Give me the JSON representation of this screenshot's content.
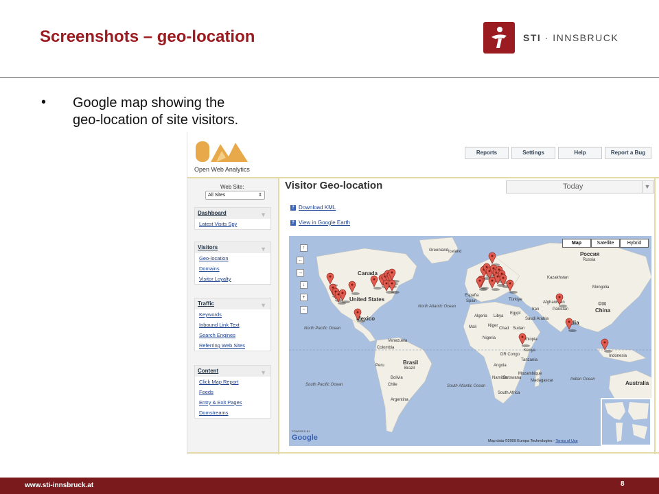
{
  "slide": {
    "title": "Screenshots – geo-location",
    "logo_brand": "STI",
    "logo_sep": " · ",
    "logo_name": "INNSBRUCK",
    "bullet": "•",
    "bullet_text": "Google map showing the geo-location of site visitors.",
    "footer_url": "www.sti-innsbruck.at",
    "page_number": "8"
  },
  "owa": {
    "app_name": "Open Web Analytics",
    "top_nav": [
      "Reports",
      "Settings",
      "Help",
      "Report a Bug"
    ],
    "web_site_label": "Web Site:",
    "web_site_value": "All Sites",
    "sections": [
      {
        "title": "Dashboard",
        "items": [
          "Latest Visits Spy"
        ]
      },
      {
        "title": "Visitors",
        "items": [
          "Geo-location",
          "Domains",
          "Visitor Loyalty"
        ]
      },
      {
        "title": "Traffic",
        "items": [
          "Keywords",
          "Inbound Link Text",
          "Search Engines",
          "Referring Web Sites"
        ]
      },
      {
        "title": "Content",
        "items": [
          "Click Map Report",
          "Feeds",
          "Entry & Exit Pages",
          "Domstreams"
        ]
      }
    ],
    "page_title": "Visitor Geo-location",
    "period": "Today",
    "links": [
      "Download KML",
      "View in Google Earth"
    ]
  },
  "map": {
    "types": [
      "Map",
      "Satellite",
      "Hybrid"
    ],
    "selected_type": "Map",
    "powered_by": "POWERED BY",
    "google": "Google",
    "attribution": "Map data ©2009 Europa Technologies -",
    "terms": "Terms of Use",
    "labels": {
      "canada": "Canada",
      "united_states": "United States",
      "mexico": "Mexico",
      "north_atlantic": "North Atlantic Ocean",
      "north_pacific": "North Pacific Ocean",
      "south_pacific": "South Pacific Ocean",
      "south_atlantic": "South Atlantic Ocean",
      "indian_ocean": "Indian Ocean",
      "brasil": "Brasil",
      "brazil": "Brazil",
      "venezuela": "Venezuela",
      "colombia": "Colombia",
      "peru": "Peru",
      "bolivia": "Bolivia",
      "chile": "Chile",
      "argentina": "Argentina",
      "iceland": "Iceland",
      "russia_native": "Россия",
      "russia": "Russia",
      "mongolia": "Mongolia",
      "china_native": "中国",
      "china": "China",
      "india": "India",
      "pakistan": "Pakistan",
      "afghanistan": "Afghanistan",
      "iran": "Iran",
      "turkiye": "Türkiye",
      "espana": "España",
      "spain": "Spain",
      "algeria": "Algeria",
      "libya": "Libya",
      "egypt": "Egypt",
      "mali": "Mali",
      "niger": "Niger",
      "chad": "Chad",
      "sudan": "Sudan",
      "ethiopia": "Ethiopia",
      "nigeria": "Nigeria",
      "dr_congo": "DR Congo",
      "kenya": "Kenya",
      "tanzania": "Tanzania",
      "angola": "Angola",
      "namibia": "Namibia",
      "botswana": "Botswana",
      "south_africa": "South Africa",
      "madagascar": "Madagascar",
      "mozambique": "Mozambique",
      "saudi_arabia": "Saudi Arabia",
      "indonesia": "Indonesia",
      "australia": "Australia",
      "kazakhstan": "Kazakhstan",
      "greenland": "Greenland"
    },
    "marker_count": 38
  },
  "colors": {
    "brand_red": "#9b1c20",
    "footer": "#7a1a1c",
    "land": "#f2efe6",
    "water": "#a9c0e0",
    "marker": "#e25b4f",
    "link": "#1a3f8f"
  }
}
